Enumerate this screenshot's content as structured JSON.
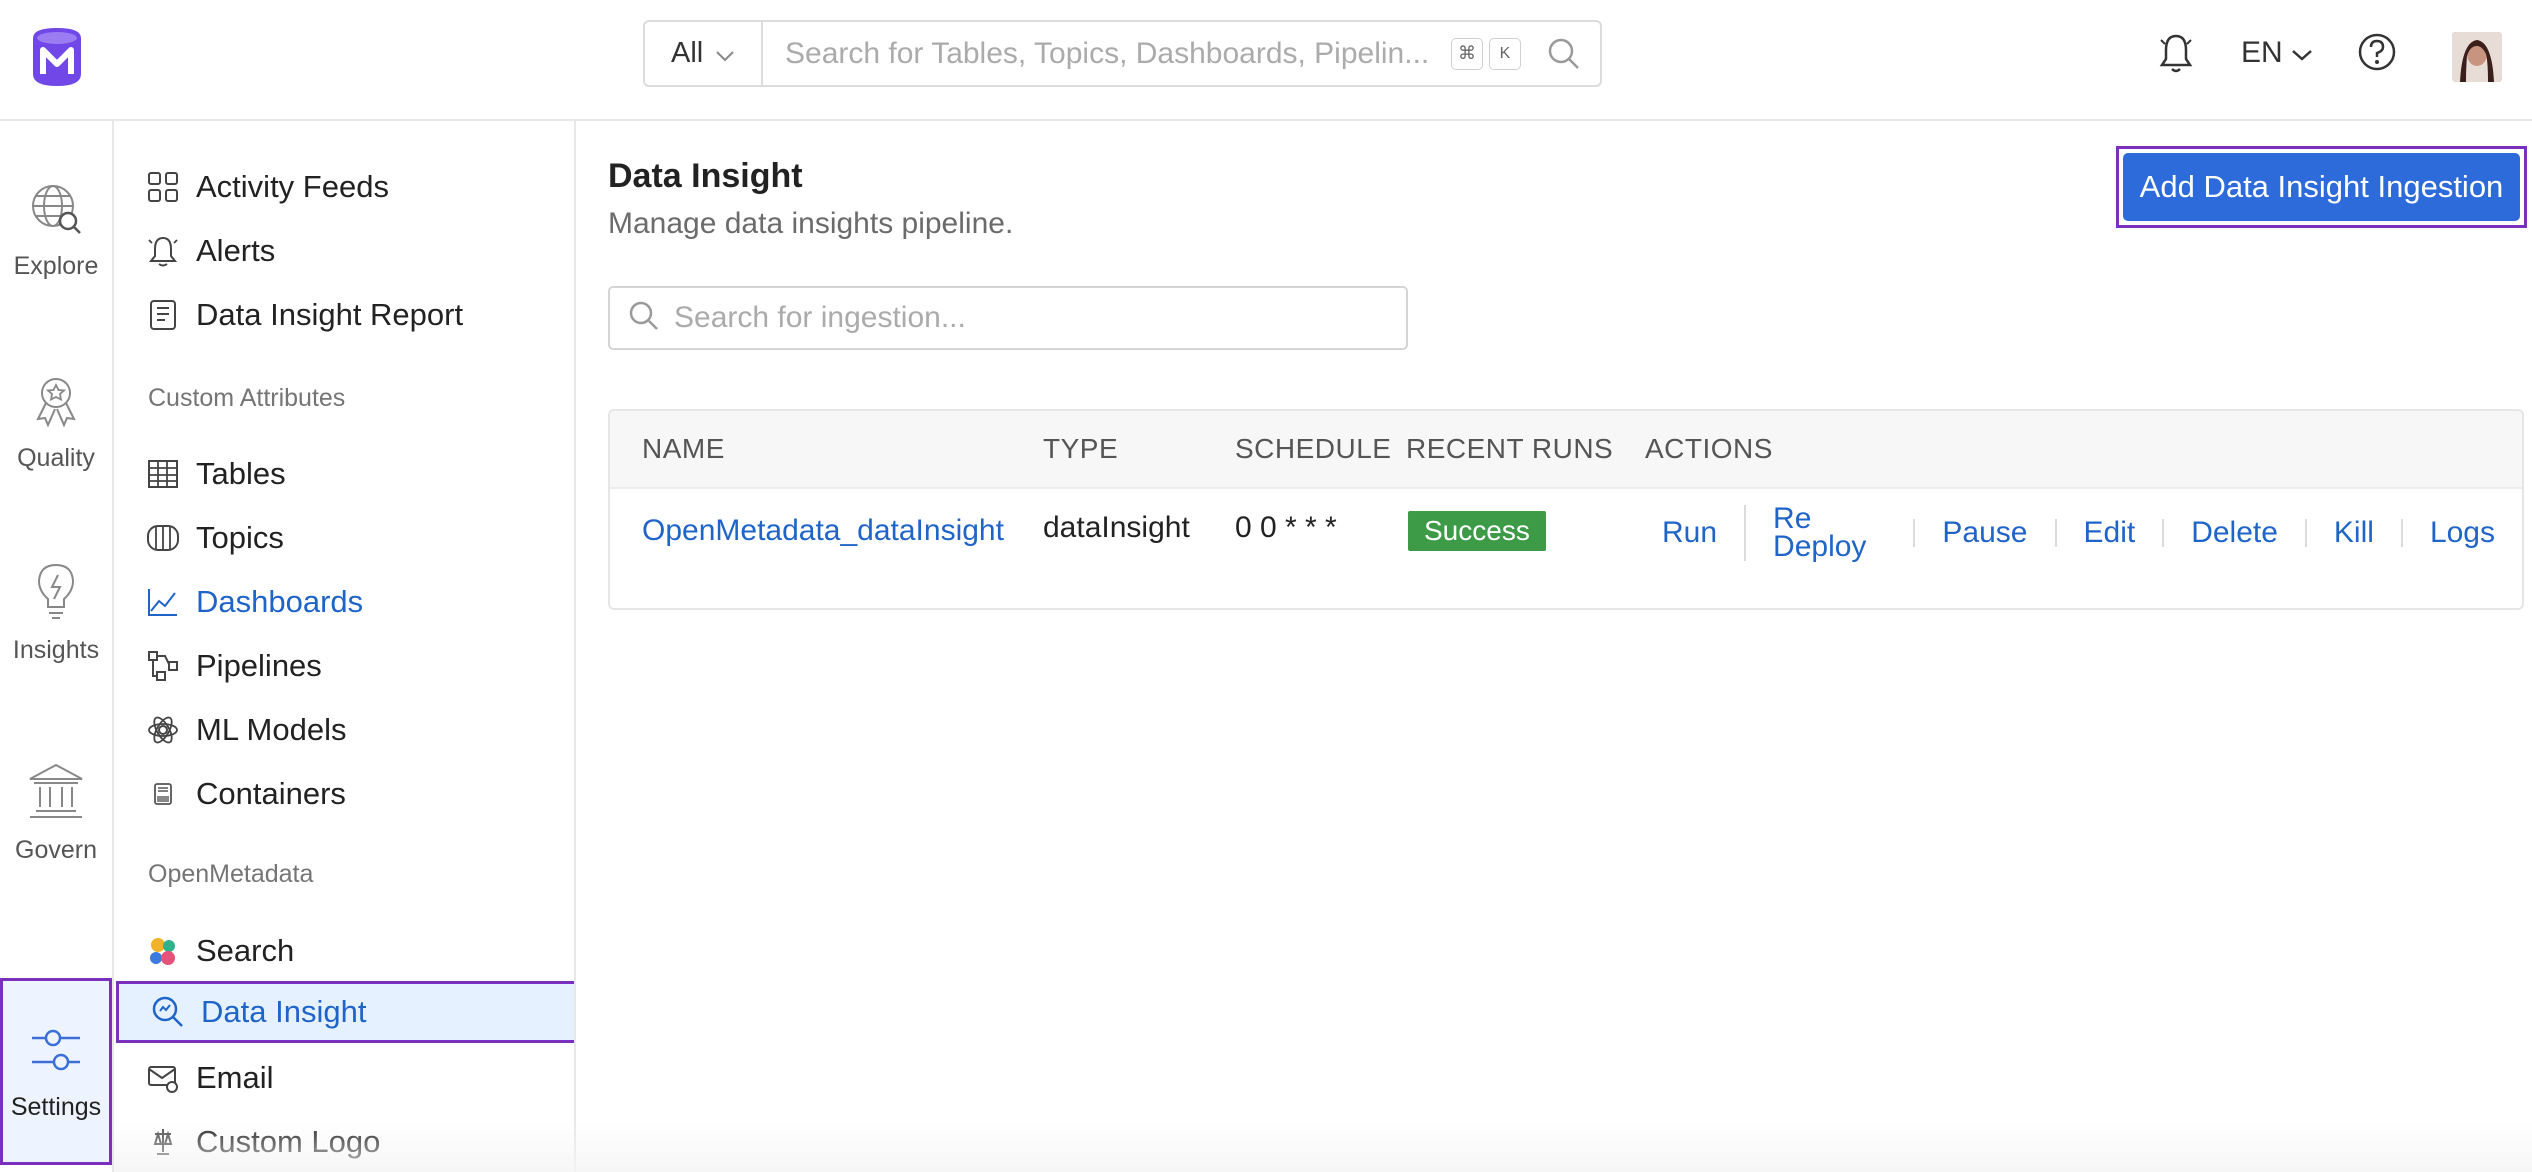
{
  "header": {
    "search_scope": "All",
    "search_placeholder": "Search for Tables, Topics, Dashboards, Pipelin...",
    "shortcut_cmd": "⌘",
    "shortcut_key": "K",
    "language": "EN"
  },
  "rail": [
    {
      "label": "Explore",
      "icon": "explore-icon"
    },
    {
      "label": "Quality",
      "icon": "quality-icon"
    },
    {
      "label": "Insights",
      "icon": "insights-icon"
    },
    {
      "label": "Govern",
      "icon": "govern-icon"
    },
    {
      "label": "Settings",
      "icon": "settings-icon",
      "active": true
    }
  ],
  "sidebar": {
    "items_top": [
      {
        "label": "Activity Feeds",
        "icon": "activity-feeds-icon"
      },
      {
        "label": "Alerts",
        "icon": "alerts-icon"
      },
      {
        "label": "Data Insight Report",
        "icon": "report-icon"
      }
    ],
    "group_custom": "Custom Attributes",
    "items_custom": [
      {
        "label": "Tables",
        "icon": "table-icon"
      },
      {
        "label": "Topics",
        "icon": "topic-icon"
      },
      {
        "label": "Dashboards",
        "icon": "dashboard-icon"
      },
      {
        "label": "Pipelines",
        "icon": "pipeline-icon"
      },
      {
        "label": "ML Models",
        "icon": "ml-model-icon"
      },
      {
        "label": "Containers",
        "icon": "container-icon"
      }
    ],
    "group_om": "OpenMetadata",
    "items_om": [
      {
        "label": "Search",
        "icon": "search-settings-icon"
      },
      {
        "label": "Data Insight",
        "icon": "data-insight-icon",
        "active": true
      },
      {
        "label": "Email",
        "icon": "email-icon"
      },
      {
        "label": "Custom Logo",
        "icon": "custom-logo-icon"
      }
    ]
  },
  "main": {
    "title": "Data Insight",
    "subtitle": "Manage data insights pipeline.",
    "add_button": "Add Data Insight Ingestion",
    "search_placeholder": "Search for ingestion...",
    "columns": [
      "NAME",
      "TYPE",
      "SCHEDULE",
      "RECENT RUNS",
      "ACTIONS"
    ],
    "rows": [
      {
        "name": "OpenMetadata_dataInsight",
        "type": "dataInsight",
        "schedule": "0 0 * * *",
        "recent_run": "Success",
        "actions": [
          "Run",
          "Re Deploy",
          "Pause",
          "Edit",
          "Delete",
          "Kill",
          "Logs"
        ]
      }
    ]
  },
  "colors": {
    "primary": "#2c6bd9",
    "link": "#1f64c8",
    "success": "#3d9a47",
    "highlight_border": "#7b2fbf",
    "logo": "#7147e8"
  }
}
